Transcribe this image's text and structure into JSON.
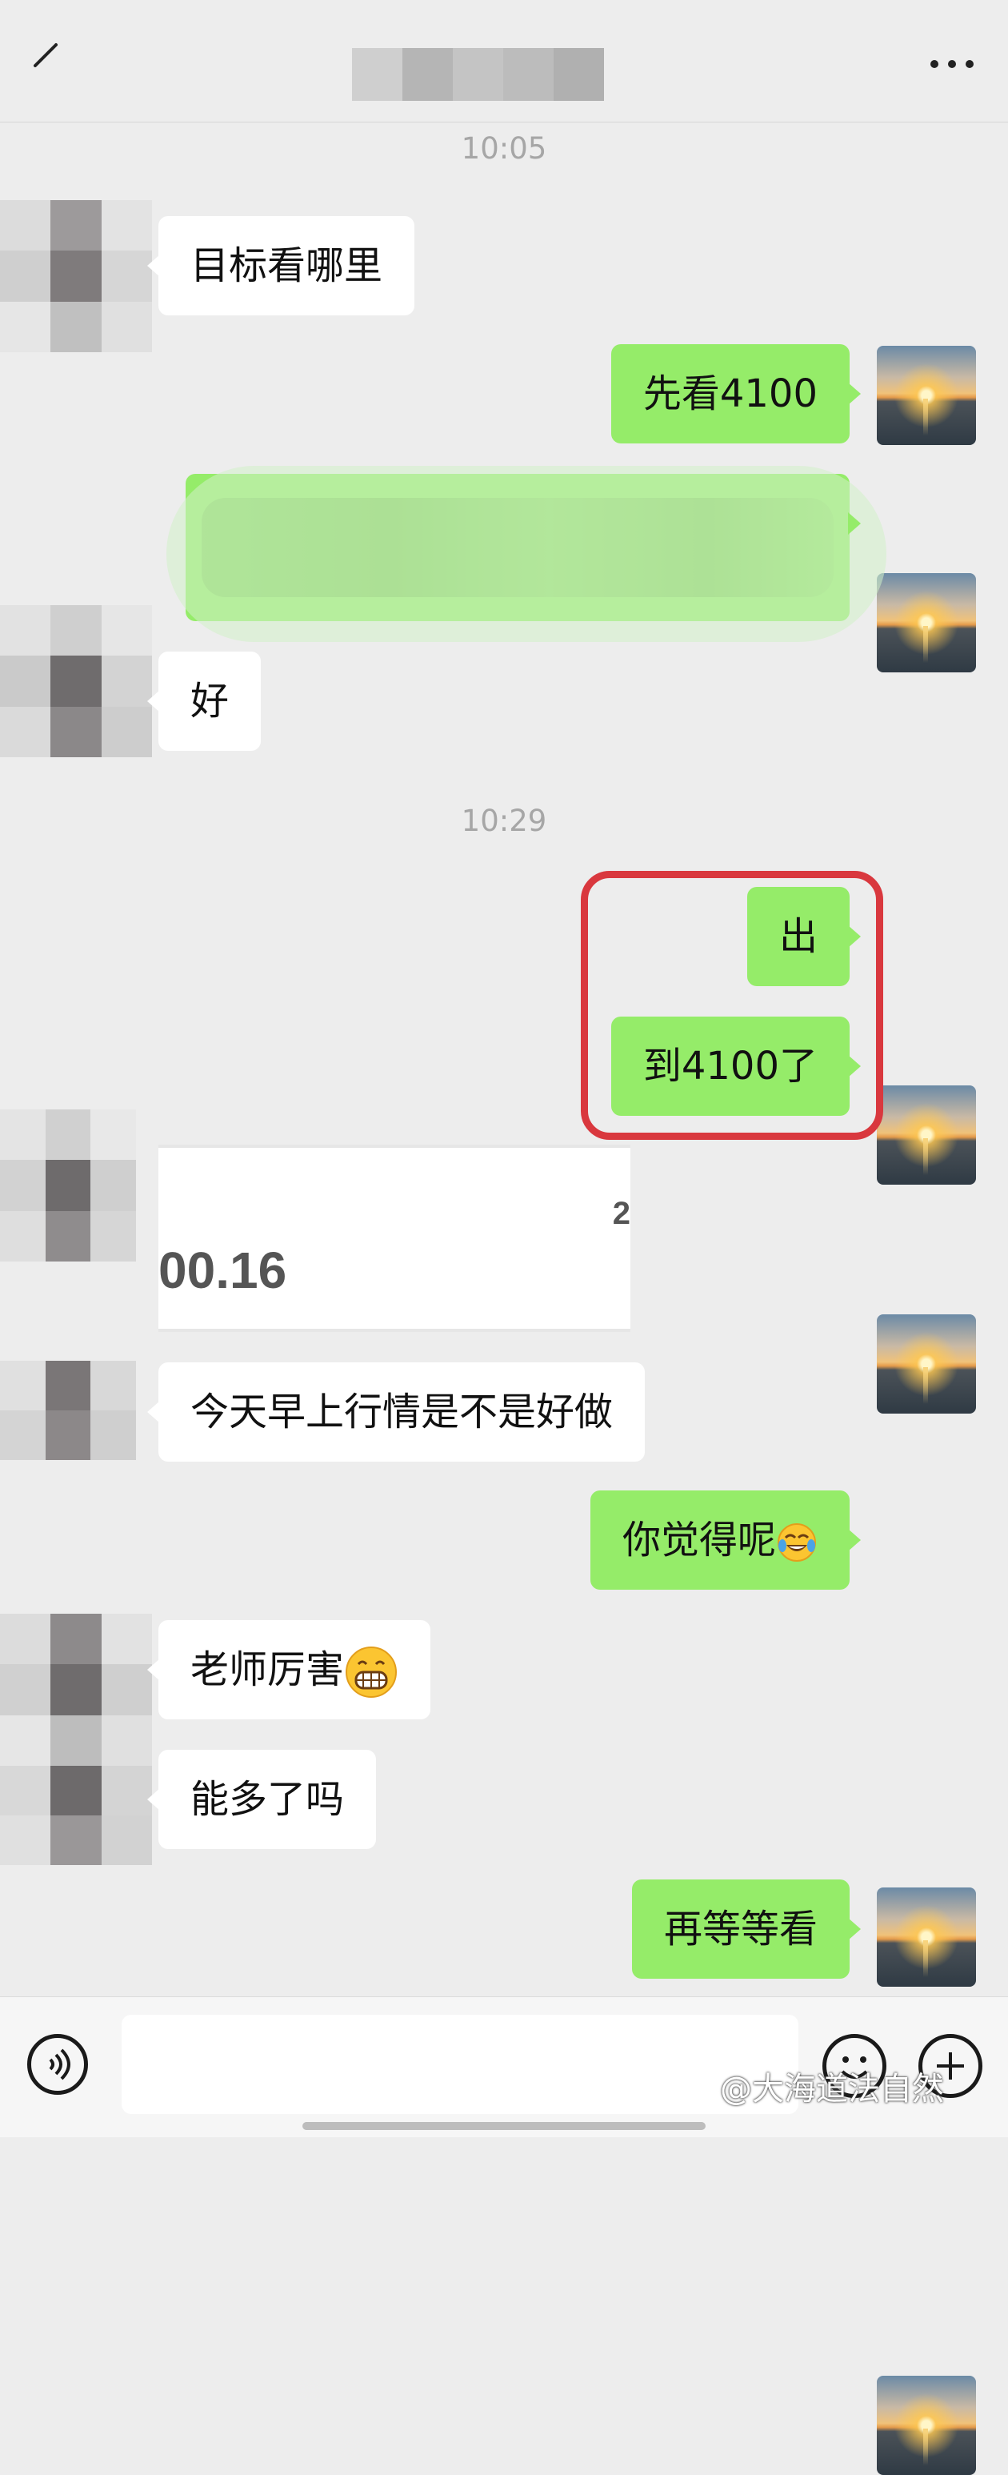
{
  "header": {
    "back_icon": "back-arrow-icon",
    "more_icon": "more-dots-icon"
  },
  "timestamps": [
    "10:05",
    "10:29"
  ],
  "messages": [
    {
      "side": "in",
      "text": "目标看哪里"
    },
    {
      "side": "out",
      "text": "先看4100"
    },
    {
      "side": "out",
      "text": "",
      "redacted": true
    },
    {
      "side": "in",
      "text": "好"
    },
    {
      "side": "out",
      "text": "出"
    },
    {
      "side": "out",
      "text": "到4100了"
    },
    {
      "side": "in",
      "type": "image",
      "image_text": "00.16",
      "image_edge_text": "2"
    },
    {
      "side": "in",
      "text": "今天早上行情是不是好做"
    },
    {
      "side": "out",
      "text": "你觉得呢",
      "emoji": "tears-of-joy-emoji"
    },
    {
      "side": "in",
      "text": "老师厉害",
      "emoji": "grinning-emoji"
    },
    {
      "side": "in",
      "text": "能多了吗"
    },
    {
      "side": "out",
      "text": "再等等看"
    }
  ],
  "input_bar": {
    "voice_icon": "voice-icon",
    "emoji_icon": "emoji-icon",
    "plus_icon": "plus-icon",
    "input_value": ""
  },
  "watermark": "@大海道法自然",
  "colors": {
    "background": "#ededed",
    "outgoing_bubble": "#95ec69",
    "incoming_bubble": "#ffffff",
    "highlight_border": "#d9383e"
  }
}
